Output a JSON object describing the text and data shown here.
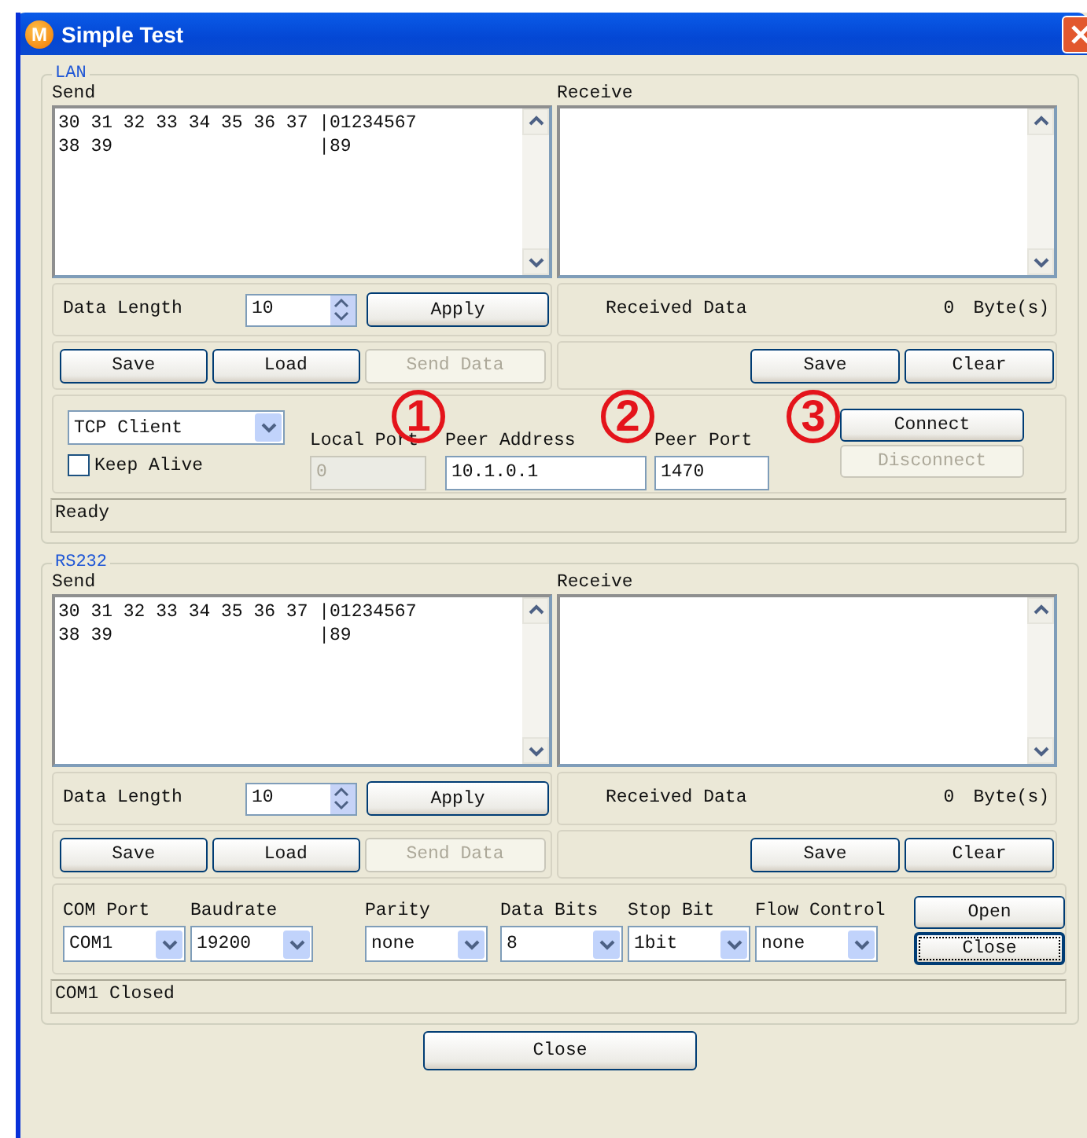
{
  "window": {
    "title": "Simple Test",
    "icon_letter": "M"
  },
  "groups": [
    {
      "title": "LAN",
      "kind": "lan",
      "send": {
        "label": "Send",
        "lines": [
          "30 31 32 33 34 35 36 37 |01234567",
          "38 39                   |89"
        ]
      },
      "receive": {
        "label": "Receive"
      },
      "data_length": {
        "label": "Data Length",
        "value": "10",
        "apply": "Apply"
      },
      "received_data": {
        "label": "Received Data",
        "count": "0",
        "unit": "Byte(s)"
      },
      "send_buttons": [
        {
          "label": "Save",
          "disabled": false
        },
        {
          "label": "Load",
          "disabled": false
        },
        {
          "label": "Send Data",
          "disabled": true
        }
      ],
      "receive_buttons": [
        {
          "label": "Save",
          "disabled": false
        },
        {
          "label": "Clear",
          "disabled": false
        }
      ],
      "mode": "TCP Client",
      "keep_alive": {
        "label": "Keep Alive",
        "checked": false
      },
      "fields": [
        {
          "label": "Local Port",
          "value": "0",
          "disabled": true
        },
        {
          "label": "Peer Address",
          "value": "10.1.0.1",
          "disabled": false
        },
        {
          "label": "Peer Port",
          "value": "1470",
          "disabled": false
        }
      ],
      "buttons": [
        {
          "label": "Connect",
          "disabled": false,
          "focused": false
        },
        {
          "label": "Disconnect",
          "disabled": true,
          "focused": false
        }
      ],
      "status": "Ready"
    },
    {
      "title": "RS232",
      "kind": "serial",
      "send": {
        "label": "Send",
        "lines": [
          "30 31 32 33 34 35 36 37 |01234567",
          "38 39                   |89"
        ]
      },
      "receive": {
        "label": "Receive"
      },
      "data_length": {
        "label": "Data Length",
        "value": "10",
        "apply": "Apply"
      },
      "received_data": {
        "label": "Received Data",
        "count": "0",
        "unit": "Byte(s)"
      },
      "send_buttons": [
        {
          "label": "Save",
          "disabled": false
        },
        {
          "label": "Load",
          "disabled": false
        },
        {
          "label": "Send Data",
          "disabled": true
        }
      ],
      "receive_buttons": [
        {
          "label": "Save",
          "disabled": false
        },
        {
          "label": "Clear",
          "disabled": false
        }
      ],
      "dropdowns": [
        {
          "label": "COM Port",
          "value": "COM1"
        },
        {
          "label": "Baudrate",
          "value": "19200"
        },
        {
          "label": "Parity",
          "value": "none"
        },
        {
          "label": "Data Bits",
          "value": "8"
        },
        {
          "label": "Stop Bit",
          "value": "1bit"
        },
        {
          "label": "Flow Control",
          "value": "none"
        }
      ],
      "buttons": [
        {
          "label": "Open",
          "disabled": false,
          "focused": false
        },
        {
          "label": "Close",
          "disabled": false,
          "focused": true
        }
      ],
      "status": "COM1 Closed"
    }
  ],
  "close_button": "Close",
  "annotations": [
    {
      "label": "1"
    },
    {
      "label": "2"
    },
    {
      "label": "3"
    }
  ]
}
